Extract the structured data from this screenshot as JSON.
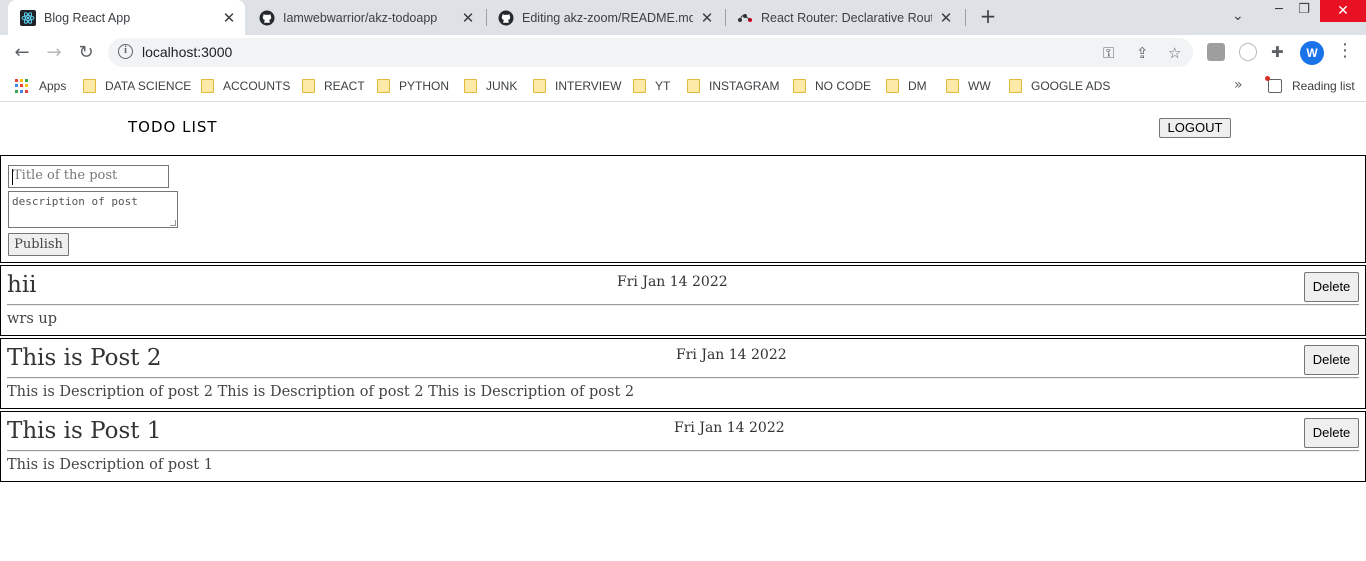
{
  "browser": {
    "tabs": [
      {
        "title": "Blog React App",
        "favicon": "react-icon",
        "active": true
      },
      {
        "title": "Iamwebwarrior/akz-todoapp",
        "favicon": "github-icon",
        "active": false
      },
      {
        "title": "Editing akz-zoom/README.md a",
        "favicon": "github-icon",
        "active": false
      },
      {
        "title": "React Router: Declarative Routing",
        "favicon": "react-router-icon",
        "active": false
      }
    ],
    "new_tab_icon": "plus-icon",
    "address": "localhost:3000",
    "profile_initial": "W",
    "bookmarks": [
      {
        "label": "Apps",
        "icon": "apps-grid-icon"
      },
      {
        "label": "DATA SCIENCE",
        "icon": "folder-icon"
      },
      {
        "label": "ACCOUNTS",
        "icon": "folder-icon"
      },
      {
        "label": "REACT",
        "icon": "folder-icon"
      },
      {
        "label": "PYTHON",
        "icon": "folder-icon"
      },
      {
        "label": "JUNK",
        "icon": "folder-icon"
      },
      {
        "label": "INTERVIEW",
        "icon": "folder-icon"
      },
      {
        "label": "YT",
        "icon": "folder-icon"
      },
      {
        "label": "INSTAGRAM",
        "icon": "folder-icon"
      },
      {
        "label": "NO CODE",
        "icon": "folder-icon"
      },
      {
        "label": "DM",
        "icon": "folder-icon"
      },
      {
        "label": "WW",
        "icon": "folder-icon"
      },
      {
        "label": "GOOGLE ADS",
        "icon": "folder-icon"
      }
    ],
    "reading_list": "Reading list"
  },
  "app": {
    "logo": "TODO LIST",
    "logout_label": "LOGOUT",
    "form": {
      "title_placeholder": "Title of the post",
      "description_placeholder": "description of post",
      "publish_label": "Publish"
    },
    "posts": [
      {
        "title": "hii",
        "date": "Fri Jan 14 2022",
        "description": "wrs up",
        "delete_label": "Delete"
      },
      {
        "title": "This is Post 2",
        "date": "Fri Jan 14 2022",
        "description": "This is Description of post 2 This is Description of post 2 This is Description of post 2",
        "delete_label": "Delete"
      },
      {
        "title": "This is Post 1",
        "date": "Fri Jan 14 2022",
        "description": "This is Description of post 1",
        "delete_label": "Delete"
      }
    ]
  },
  "colors": {
    "tabstrip_bg": "#dee1e6",
    "close_window_bg": "#e81123",
    "profile_bg": "#1a73e8",
    "folder_fill": "#fde9a8"
  }
}
